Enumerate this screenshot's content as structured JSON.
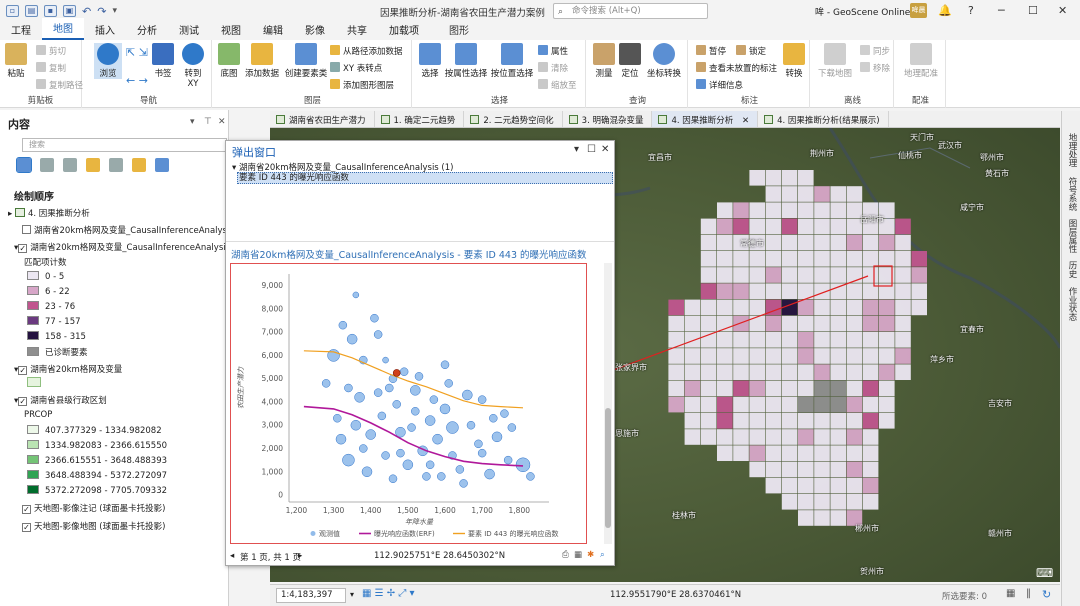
{
  "window": {
    "title": "因果推断分析-湖南省农田生产潜力案例",
    "search_placeholder": "命令搜索 (Alt+Q)",
    "user": "哞 - GeoScene Online",
    "avatar_text": "哞晨",
    "help": "?",
    "min": "─",
    "max": "☐",
    "close": "✕",
    "notify": "🔔"
  },
  "tabs": [
    "工程",
    "地图",
    "插入",
    "分析",
    "测试",
    "视图",
    "编辑",
    "影像",
    "共享",
    "加载项",
    "图形"
  ],
  "ribbon": {
    "groups": [
      {
        "label": "剪贴板",
        "big": [
          {
            "label": "粘贴"
          }
        ],
        "small": [
          "剪切",
          "复制",
          "复制路径"
        ]
      },
      {
        "label": "导航",
        "big": [
          {
            "label": "浏览"
          },
          {
            "label": "书签"
          },
          {
            "label": "转到 XY"
          }
        ],
        "small": []
      },
      {
        "label": "图层",
        "big": [
          {
            "label": "底图"
          },
          {
            "label": "添加数据"
          },
          {
            "label": "创建要素类"
          }
        ],
        "small": [
          "从路径添加数据",
          "XY 表转点",
          "添加图形图层"
        ]
      },
      {
        "label": "选择",
        "big": [
          {
            "label": "选择"
          },
          {
            "label": "按属性选择"
          },
          {
            "label": "按位置选择"
          }
        ],
        "small": [
          "属性",
          "清除",
          "缩放至"
        ]
      },
      {
        "label": "查询",
        "big": [
          {
            "label": "测量"
          },
          {
            "label": "定位"
          },
          {
            "label": "坐标转换"
          }
        ],
        "small": []
      },
      {
        "label": "标注",
        "big": [
          {
            "label": "转换"
          }
        ],
        "small": [
          "暂停",
          "锁定",
          "查看未放置的标注",
          "详细信息"
        ]
      },
      {
        "label": "离线",
        "big": [
          {
            "label": "下载地图"
          }
        ],
        "small": [
          "同步",
          "移除"
        ]
      },
      {
        "label": "配准",
        "big": [
          {
            "label": "地理配准"
          }
        ],
        "small": []
      }
    ]
  },
  "contents": {
    "title": "内容",
    "search_placeholder": "搜索",
    "draw_order": "绘制顺序",
    "map_name": "4. 因果推断分析",
    "layer1": "湖南省20km格网及变量_CausalInferenceAnalysis",
    "layer2": "湖南省20km格网及变量_CausalInferenceAnalysis",
    "field_label": "匹配项计数",
    "legend1": [
      {
        "label": "0 - 5",
        "color": "#ece7f2"
      },
      {
        "label": "6 - 22",
        "color": "#d7a6c8"
      },
      {
        "label": "23 - 76",
        "color": "#c0558e"
      },
      {
        "label": "77 - 157",
        "color": "#6b3a80"
      },
      {
        "label": "158 - 315",
        "color": "#24123f"
      },
      {
        "label": "已诊断要素",
        "color": "#8f8f8f"
      }
    ],
    "layer3": "湖南省20km格网及变量",
    "layer4": "湖南省县级行政区划",
    "field2": "PRCOP",
    "legend2": [
      {
        "label": "407.377329 - 1334.982082",
        "color": "#edf8e9"
      },
      {
        "label": "1334.982083 - 2366.615550",
        "color": "#bae4b3"
      },
      {
        "label": "2366.615551 - 3648.488393",
        "color": "#74c476"
      },
      {
        "label": "3648.488394 - 5372.272097",
        "color": "#31a354"
      },
      {
        "label": "5372.272098 - 7705.709332",
        "color": "#006d2c"
      }
    ],
    "layer5": "天地图-影像注记 (球面墨卡托投影)",
    "layer6": "天地图-影像地图 (球面墨卡托投影)"
  },
  "view_tabs": [
    "湖南省农田生产潜力",
    "1. 确定二元趋势",
    "2. 二元趋势空间化",
    "3. 明确混杂变量",
    "4. 因果推断分析",
    "4. 因果推断分析(结果展示)"
  ],
  "right_panel": [
    "地理处理",
    "符号系统",
    "图层属性",
    "历史",
    "作业状态"
  ],
  "popup": {
    "title": "弹出窗口",
    "tree_parent": "湖南省20km格网及变量_CausalInferenceAnalysis (1)",
    "tree_child": "要素 ID 443 的曝光响应函数",
    "header": "湖南省20km格网及变量_CausalInferenceAnalysis - 要素 ID 443 的曝光响应函数",
    "page": "第 1 页, 共 1 页",
    "coords": "112.9025751°E 28.6450302°N"
  },
  "map_cities": [
    {
      "name": "天门市"
    },
    {
      "name": "武汉市"
    },
    {
      "name": "鄂州市"
    },
    {
      "name": "仙桃市"
    },
    {
      "name": "黄石市"
    },
    {
      "name": "荆州市"
    },
    {
      "name": "咸宁市"
    },
    {
      "name": "宜昌市"
    },
    {
      "name": "常德市"
    },
    {
      "name": "岳阳市"
    },
    {
      "name": "宜春市"
    },
    {
      "name": "萍乡市"
    },
    {
      "name": "吉安市"
    },
    {
      "name": "桂林市"
    },
    {
      "name": "郴州市"
    },
    {
      "name": "赣州市"
    },
    {
      "name": "贺州市"
    },
    {
      "name": "张家界市"
    },
    {
      "name": "恩施市"
    }
  ],
  "status": {
    "scale": "1:4,183,397",
    "coords": "112.9551790°E 28.6370461°N",
    "selected": "所选要素: 0"
  },
  "chart_data": {
    "type": "scatter",
    "title": "",
    "xlabel": "年降水量",
    "ylabel": "农田生产潜力",
    "xlim": [
      1180,
      1880
    ],
    "ylim": [
      -300,
      9500
    ],
    "x_ticks": [
      1200,
      1300,
      1400,
      1500,
      1600,
      1700,
      1800
    ],
    "y_ticks": [
      0,
      1000,
      2000,
      3000,
      4000,
      5000,
      6000,
      7000,
      8000,
      9000
    ],
    "x_tick_labels": [
      "1,200",
      "1,300",
      "1,400",
      "1,500",
      "1,600",
      "1,700",
      "1,800"
    ],
    "y_tick_labels": [
      "0",
      "1,000",
      "2,000",
      "3,000",
      "4,000",
      "5,000",
      "6,000",
      "7,000",
      "8,000",
      "9,000"
    ],
    "series": [
      {
        "name": "观测值",
        "color": "#4a8fdc"
      },
      {
        "name": "曝光响应函数(ERF)",
        "color": "#b0189a",
        "x": [
          1220,
          1300,
          1350,
          1400,
          1450,
          1500,
          1550,
          1600,
          1650,
          1700,
          1750,
          1810
        ],
        "y": [
          3800,
          3700,
          3450,
          3100,
          2700,
          2250,
          1900,
          1650,
          1450,
          1350,
          1300,
          1250
        ]
      },
      {
        "name": "要素 ID 443 的曝光响应函数",
        "color": "#f0a020",
        "x": [
          1220,
          1300,
          1350,
          1400,
          1450,
          1500,
          1550,
          1600,
          1650,
          1700,
          1750,
          1810
        ],
        "y": [
          6200,
          6150,
          5900,
          5550,
          5200,
          4900,
          4650,
          4350,
          4050,
          3850,
          3800,
          3750
        ]
      }
    ],
    "observed": [
      {
        "x": 1490,
        "y": 5300,
        "r": 4
      },
      {
        "x": 1420,
        "y": 6900,
        "r": 4
      },
      {
        "x": 1520,
        "y": 4500,
        "r": 5
      },
      {
        "x": 1325,
        "y": 7300,
        "r": 4
      },
      {
        "x": 1350,
        "y": 6700,
        "r": 5
      },
      {
        "x": 1660,
        "y": 4300,
        "r": 5
      },
      {
        "x": 1760,
        "y": 3500,
        "r": 4
      },
      {
        "x": 1810,
        "y": 1300,
        "r": 7
      },
      {
        "x": 1600,
        "y": 3700,
        "r": 5
      },
      {
        "x": 1450,
        "y": 4600,
        "r": 4
      },
      {
        "x": 1380,
        "y": 5800,
        "r": 4
      },
      {
        "x": 1300,
        "y": 6000,
        "r": 6
      },
      {
        "x": 1560,
        "y": 3200,
        "r": 5
      },
      {
        "x": 1690,
        "y": 2200,
        "r": 4
      },
      {
        "x": 1400,
        "y": 2600,
        "r": 5
      },
      {
        "x": 1480,
        "y": 1800,
        "r": 4
      },
      {
        "x": 1340,
        "y": 1500,
        "r": 6
      },
      {
        "x": 1620,
        "y": 1700,
        "r": 4
      },
      {
        "x": 1720,
        "y": 900,
        "r": 5
      },
      {
        "x": 1430,
        "y": 3400,
        "r": 4
      },
      {
        "x": 1510,
        "y": 2900,
        "r": 4
      },
      {
        "x": 1580,
        "y": 2400,
        "r": 5
      },
      {
        "x": 1640,
        "y": 1100,
        "r": 4
      },
      {
        "x": 1770,
        "y": 1500,
        "r": 4
      },
      {
        "x": 1370,
        "y": 4200,
        "r": 5
      },
      {
        "x": 1530,
        "y": 5100,
        "r": 4
      },
      {
        "x": 1460,
        "y": 700,
        "r": 4
      },
      {
        "x": 1310,
        "y": 3300,
        "r": 4
      },
      {
        "x": 1670,
        "y": 3000,
        "r": 4
      },
      {
        "x": 1740,
        "y": 2500,
        "r": 5
      },
      {
        "x": 1410,
        "y": 7600,
        "r": 4
      },
      {
        "x": 1360,
        "y": 8600,
        "r": 3
      },
      {
        "x": 1500,
        "y": 1300,
        "r": 5
      },
      {
        "x": 1550,
        "y": 800,
        "r": 4
      },
      {
        "x": 1280,
        "y": 4800,
        "r": 4
      },
      {
        "x": 1600,
        "y": 5600,
        "r": 4
      },
      {
        "x": 1700,
        "y": 4100,
        "r": 4
      },
      {
        "x": 1440,
        "y": 5800,
        "r": 3
      },
      {
        "x": 1620,
        "y": 2900,
        "r": 6
      },
      {
        "x": 1390,
        "y": 1000,
        "r": 5
      },
      {
        "x": 1470,
        "y": 3900,
        "r": 4
      },
      {
        "x": 1320,
        "y": 2400,
        "r": 5
      },
      {
        "x": 1570,
        "y": 4100,
        "r": 4
      },
      {
        "x": 1650,
        "y": 500,
        "r": 4
      },
      {
        "x": 1780,
        "y": 2900,
        "r": 4
      },
      {
        "x": 1830,
        "y": 800,
        "r": 4
      },
      {
        "x": 1540,
        "y": 1900,
        "r": 5
      },
      {
        "x": 1420,
        "y": 4400,
        "r": 4
      },
      {
        "x": 1480,
        "y": 2700,
        "r": 5
      },
      {
        "x": 1520,
        "y": 3600,
        "r": 4
      },
      {
        "x": 1700,
        "y": 1800,
        "r": 4
      },
      {
        "x": 1360,
        "y": 3000,
        "r": 5
      },
      {
        "x": 1440,
        "y": 1700,
        "r": 4
      },
      {
        "x": 1590,
        "y": 800,
        "r": 4
      },
      {
        "x": 1340,
        "y": 4600,
        "r": 4
      },
      {
        "x": 1460,
        "y": 5000,
        "r": 4
      },
      {
        "x": 1610,
        "y": 4800,
        "r": 4
      },
      {
        "x": 1730,
        "y": 3300,
        "r": 4
      },
      {
        "x": 1560,
        "y": 1300,
        "r": 4
      },
      {
        "x": 1380,
        "y": 2000,
        "r": 4
      }
    ],
    "highlight": {
      "x": 1470,
      "y": 5250
    }
  }
}
